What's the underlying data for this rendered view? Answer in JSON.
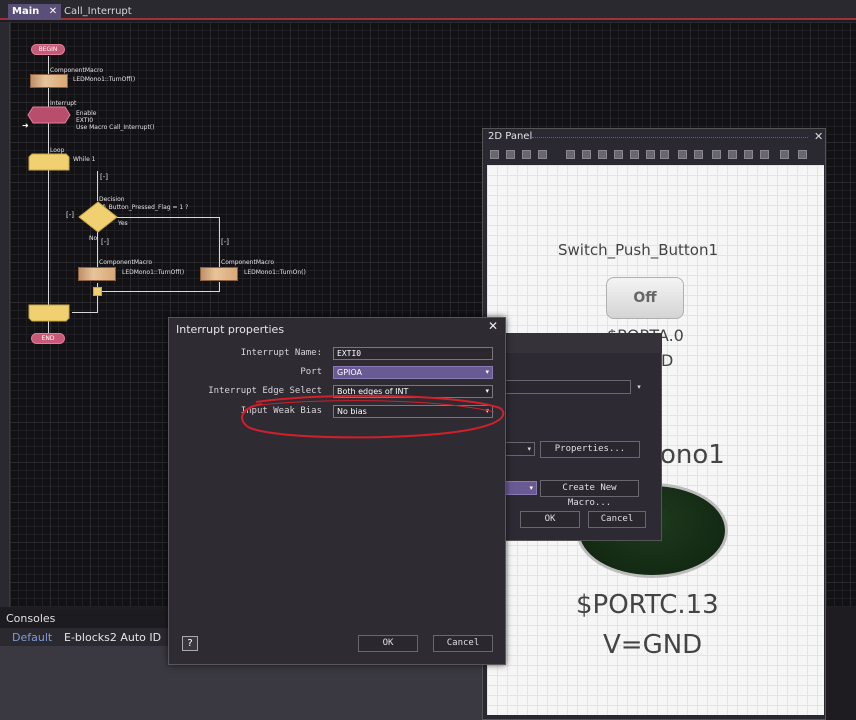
{
  "tabs": [
    {
      "label": "Main",
      "close": "✕"
    },
    {
      "label": "Call_Interrupt"
    }
  ],
  "flowchart": {
    "begin": "BEGIN",
    "end": "END",
    "macro1_type": "ComponentMacro",
    "macro1_call": "LEDMono1::TurnOff()",
    "interrupt_label": "Interrupt",
    "interrupt_enable": "Enable",
    "interrupt_source": "EXTI0",
    "interrupt_macro": "Use Macro Call_Interrupt()",
    "loop_label": "Loop",
    "loop_cond": "While 1",
    "collapse": "[-]",
    "decision_label": "Decision",
    "decision_cond": "If: Button_Pressed_Flag = 1 ?",
    "no": "No",
    "yes": "Yes",
    "macro2_type": "ComponentMacro",
    "macro2_call": "LEDMono1::TurnOff()",
    "macro3_type": "ComponentMacro",
    "macro3_call": "LEDMono1::TurnOn()"
  },
  "consoles": {
    "title": "Consoles",
    "tabs": [
      "Default",
      "E-blocks2 Auto ID"
    ]
  },
  "panel": {
    "title": "2D Panel",
    "close": "✕",
    "switch_name": "Switch_Push_Button1",
    "switch_state": "Off",
    "switch_port_partial": "$PORTA.0",
    "switch_v_partial": "D",
    "led_name_partial": "ono1",
    "led_port": "$PORTC.13",
    "led_v": "V=GND"
  },
  "behind_dialog": {
    "properties_btn": "Properties...",
    "create_macro_btn": "Create New Macro...",
    "ok": "OK",
    "cancel": "Cancel"
  },
  "dialog": {
    "title": "Interrupt properties",
    "close": "✕",
    "fields": [
      {
        "label": "Interrupt Name:",
        "value": "EXTI0"
      },
      {
        "label": "Port",
        "value": "GPIOA"
      },
      {
        "label": "Interrupt Edge Select",
        "value": "Both edges of INT"
      },
      {
        "label": "Input Weak Bias",
        "value": "No bias"
      }
    ],
    "help": "?",
    "ok": "OK",
    "cancel": "Cancel"
  },
  "colors": {
    "accent": "#6a5a94",
    "highlight_circle": "#d0202a"
  }
}
